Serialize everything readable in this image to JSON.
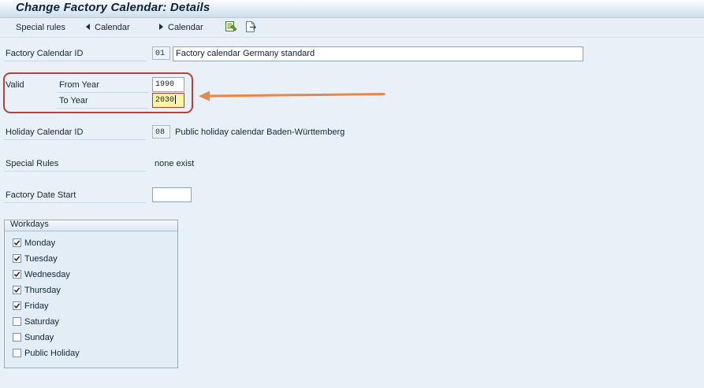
{
  "header": {
    "title": "Change Factory Calendar: Details"
  },
  "toolbar": {
    "special_rules_label": "Special rules",
    "prev_calendar_label": "Calendar",
    "next_calendar_label": "Calendar",
    "icons": [
      "edit-list-icon",
      "export-icon"
    ]
  },
  "form": {
    "factory_calendar_id": {
      "label": "Factory Calendar ID",
      "code": "01",
      "description": "Factory calendar Germany standard"
    },
    "valid": {
      "label": "Valid",
      "from_year_label": "From Year",
      "from_year_value": "1990",
      "to_year_label": "To Year",
      "to_year_value": "2030"
    },
    "holiday_calendar_id": {
      "label": "Holiday Calendar ID",
      "code": "08",
      "description": "Public holiday calendar Baden-Württemberg"
    },
    "special_rules": {
      "label": "Special Rules",
      "value": "none exist"
    },
    "factory_date_start": {
      "label": "Factory Date Start",
      "value": ""
    }
  },
  "workdays": {
    "title": "Workdays",
    "items": [
      {
        "label": "Monday",
        "checked": true
      },
      {
        "label": "Tuesday",
        "checked": true
      },
      {
        "label": "Wednesday",
        "checked": true
      },
      {
        "label": "Thursday",
        "checked": true
      },
      {
        "label": "Friday",
        "checked": true
      },
      {
        "label": "Saturday",
        "checked": false
      },
      {
        "label": "Sunday",
        "checked": false
      },
      {
        "label": "Public Holiday",
        "checked": false
      }
    ]
  },
  "colors": {
    "highlight_frame": "#b8403a",
    "annotation_arrow": "#e8874a",
    "focused_field_bg": "#fdf4a6"
  }
}
